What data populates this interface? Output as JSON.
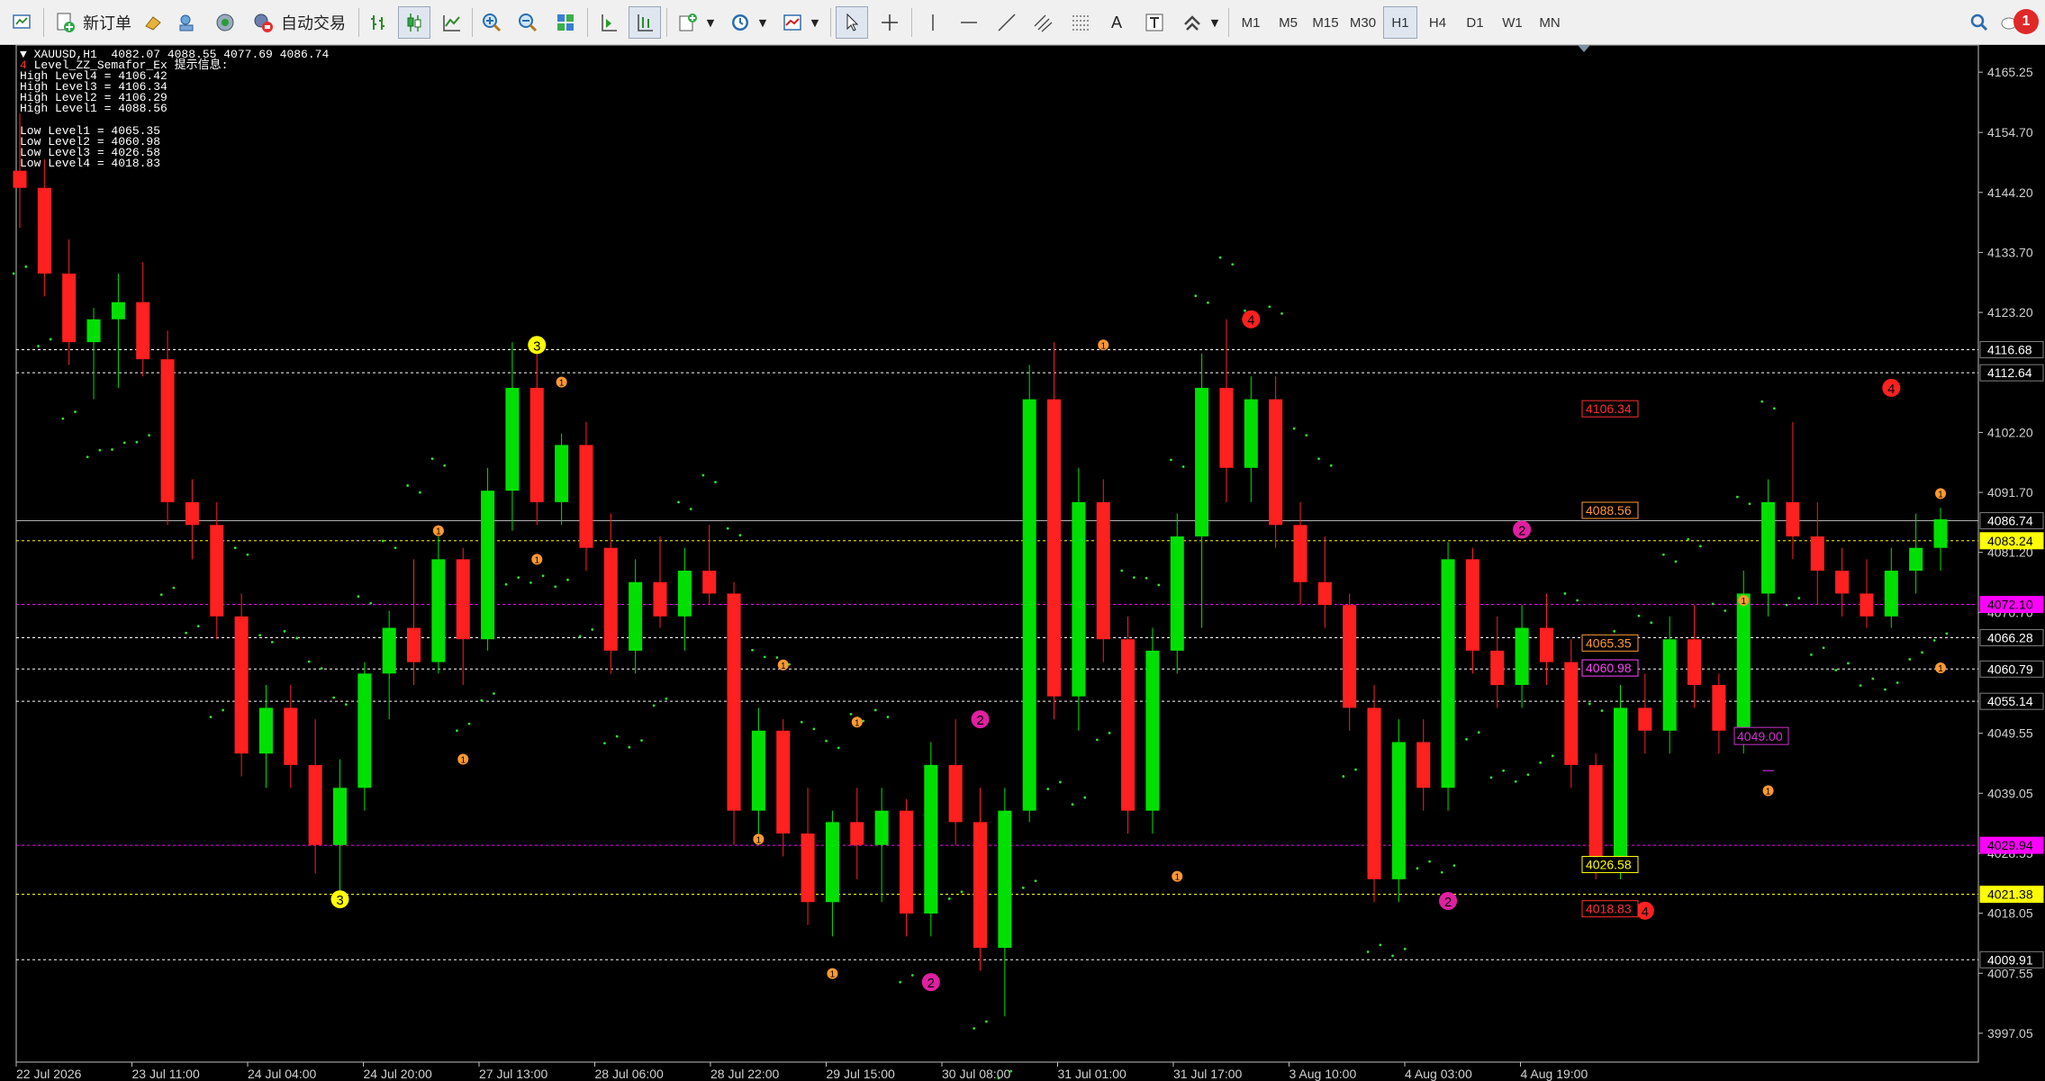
{
  "toolbar": {
    "new_order_label": "新订单",
    "auto_trade_label": "自动交易",
    "periods": [
      "M1",
      "M5",
      "M15",
      "M30",
      "H1",
      "H4",
      "D1",
      "W1",
      "MN"
    ],
    "active_period": "H1",
    "notification_count": "1"
  },
  "chart": {
    "symbol_line": "XAUUSD,H1  4082.07 4088.55 4077.69 4086.74",
    "indicator_line": "Level_ZZ_Semafor_Ex 提示信息:",
    "high_levels": [
      "High Level4 = 4106.42",
      "High Level3 = 4106.34",
      "High Level2 = 4106.29",
      "High Level1 = 4088.56"
    ],
    "low_levels": [
      "Low Level1 = 4065.35",
      "Low Level2 = 4060.98",
      "Low Level3 = 4026.58",
      "Low Level4 = 4018.83"
    ],
    "bid_price": "4086.74"
  },
  "chart_data": {
    "type": "candlestick",
    "symbol": "XAUUSD",
    "timeframe": "H1",
    "ylim": [
      3992,
      4170
    ],
    "price_ticks": [
      4165.25,
      4154.7,
      4144.2,
      4133.7,
      4123.2,
      4102.2,
      4091.7,
      4081.2,
      4070.7,
      4049.55,
      4039.05,
      4028.55,
      4018.05,
      4007.55,
      3997.05
    ],
    "time_labels": [
      "22 Jul 2026",
      "23 Jul 11:00",
      "24 Jul 04:00",
      "24 Jul 20:00",
      "27 Jul 13:00",
      "28 Jul 06:00",
      "28 Jul 22:00",
      "29 Jul 15:00",
      "30 Jul 08:00",
      "31 Jul 01:00",
      "31 Jul 17:00",
      "3 Aug 10:00",
      "4 Aug 03:00",
      "4 Aug 19:00"
    ],
    "horizontal_lines": [
      {
        "price": 4116.68,
        "label": "4116.68",
        "color": "#ffffff",
        "box": "#000000",
        "style": "dotted"
      },
      {
        "price": 4112.64,
        "label": "4112.64",
        "color": "#ffffff",
        "box": "#000000",
        "style": "dotted"
      },
      {
        "price": 4086.74,
        "label": "4086.74",
        "color": "#b0b0b0",
        "box": "#000000",
        "style": "solid"
      },
      {
        "price": 4083.24,
        "label": "4083.24",
        "color": "#ffff00",
        "box": "#ffff00",
        "style": "dotted"
      },
      {
        "price": 4072.1,
        "label": "4072.10",
        "color": "#ff00ff",
        "box": "#ff00ff",
        "style": "dotted"
      },
      {
        "price": 4066.28,
        "label": "4066.28",
        "color": "#ffffff",
        "box": "#000000",
        "style": "dotted"
      },
      {
        "price": 4060.79,
        "label": "4060.79",
        "color": "#ffffff",
        "box": "#000000",
        "style": "dotted"
      },
      {
        "price": 4055.14,
        "label": "4055.14",
        "color": "#ffffff",
        "box": "#000000",
        "style": "dotted"
      },
      {
        "price": 4029.94,
        "label": "4029.94",
        "color": "#ff00ff",
        "box": "#ff00ff",
        "style": "dotted"
      },
      {
        "price": 4021.38,
        "label": "4021.38",
        "color": "#ffff00",
        "box": "#ffff00",
        "style": "dotted"
      },
      {
        "price": 4009.91,
        "label": "4009.91",
        "color": "#ffffff",
        "box": "#000000",
        "style": "dotted"
      }
    ],
    "level_tags": [
      {
        "price": 4106.34,
        "label": "4106.34",
        "color": "#ff3030"
      },
      {
        "price": 4088.56,
        "label": "4088.56",
        "color": "#ff9933"
      },
      {
        "price": 4065.35,
        "label": "4065.35",
        "color": "#ff9933"
      },
      {
        "price": 4060.98,
        "label": "4060.98",
        "color": "#ff44ff"
      },
      {
        "price": 4026.58,
        "label": "4026.58",
        "color": "#ffff00"
      },
      {
        "price": 4018.83,
        "label": "4018.83",
        "color": "#ff3030"
      }
    ],
    "hline_4049": {
      "price": 4049.0,
      "label": "4049.00",
      "color": "#cc33cc"
    },
    "trend_line_price": 4043.0,
    "markers": [
      {
        "n": "3",
        "i": 21,
        "price": 4117.5,
        "color": "#ffff00"
      },
      {
        "n": "3",
        "i": 13,
        "price": 4020.5,
        "color": "#ffff00"
      },
      {
        "n": "4",
        "i": 50,
        "price": 4122.0,
        "color": "#ff2020"
      },
      {
        "n": "4",
        "i": 76,
        "price": 4110.0,
        "color": "#ff2020"
      },
      {
        "n": "4",
        "i": 66,
        "price": 4018.5,
        "color": "#ff2020"
      },
      {
        "n": "2",
        "i": 39,
        "price": 4052.0,
        "color": "#e020a0"
      },
      {
        "n": "2",
        "i": 37,
        "price": 4006.0,
        "color": "#e020a0"
      },
      {
        "n": "2",
        "i": 61,
        "price": 4085.2,
        "color": "#e020a0"
      },
      {
        "n": "2",
        "i": 58,
        "price": 4020.2,
        "color": "#e020a0"
      },
      {
        "n": "1",
        "i": 17,
        "price": 4085.0,
        "color": "#ff9933"
      },
      {
        "n": "1",
        "i": 22,
        "price": 4111.0,
        "color": "#ff9933"
      },
      {
        "n": "1",
        "i": 21,
        "price": 4080.0,
        "color": "#ff9933"
      },
      {
        "n": "1",
        "i": 18,
        "price": 4045.0,
        "color": "#ff9933"
      },
      {
        "n": "1",
        "i": 31,
        "price": 4061.5,
        "color": "#ff9933"
      },
      {
        "n": "1",
        "i": 34,
        "price": 4051.5,
        "color": "#ff9933"
      },
      {
        "n": "1",
        "i": 30,
        "price": 4031.0,
        "color": "#ff9933"
      },
      {
        "n": "1",
        "i": 33,
        "price": 4007.5,
        "color": "#ff9933"
      },
      {
        "n": "1",
        "i": 44,
        "price": 4117.5,
        "color": "#ff9933"
      },
      {
        "n": "1",
        "i": 47,
        "price": 4024.5,
        "color": "#ff9933"
      },
      {
        "n": "1",
        "i": 70,
        "price": 4072.8,
        "color": "#ff9933"
      },
      {
        "n": "1",
        "i": 71,
        "price": 4039.5,
        "color": "#ff9933"
      },
      {
        "n": "1",
        "i": 78,
        "price": 4091.5,
        "color": "#ff9933"
      },
      {
        "n": "1",
        "i": 78,
        "price": 4061.0,
        "color": "#ff9933"
      }
    ],
    "candles": [
      [
        4148,
        4158,
        4138,
        4145
      ],
      [
        4145,
        4150,
        4126,
        4130
      ],
      [
        4130,
        4136,
        4114,
        4118
      ],
      [
        4118,
        4124,
        4108,
        4122
      ],
      [
        4122,
        4130,
        4110,
        4125
      ],
      [
        4125,
        4132,
        4112,
        4115
      ],
      [
        4115,
        4120,
        4086,
        4090
      ],
      [
        4090,
        4094,
        4080,
        4086
      ],
      [
        4086,
        4090,
        4066,
        4070
      ],
      [
        4070,
        4074,
        4042,
        4046
      ],
      [
        4046,
        4058,
        4040,
        4054
      ],
      [
        4054,
        4058,
        4040,
        4044
      ],
      [
        4044,
        4052,
        4025,
        4030
      ],
      [
        4030,
        4045,
        4022,
        4040
      ],
      [
        4040,
        4062,
        4036,
        4060
      ],
      [
        4060,
        4071,
        4052,
        4068
      ],
      [
        4068,
        4080,
        4058,
        4062
      ],
      [
        4062,
        4084,
        4060,
        4080
      ],
      [
        4080,
        4082,
        4058,
        4066
      ],
      [
        4066,
        4096,
        4064,
        4092
      ],
      [
        4092,
        4118,
        4085,
        4110
      ],
      [
        4110,
        4116,
        4086,
        4090
      ],
      [
        4090,
        4102,
        4086,
        4100
      ],
      [
        4100,
        4104,
        4078,
        4082
      ],
      [
        4082,
        4088,
        4060,
        4064
      ],
      [
        4064,
        4080,
        4060,
        4076
      ],
      [
        4076,
        4084,
        4068,
        4070
      ],
      [
        4070,
        4082,
        4064,
        4078
      ],
      [
        4078,
        4086,
        4072,
        4074
      ],
      [
        4074,
        4076,
        4030,
        4036
      ],
      [
        4036,
        4054,
        4030,
        4050
      ],
      [
        4050,
        4052,
        4028,
        4032
      ],
      [
        4032,
        4040,
        4016,
        4020
      ],
      [
        4020,
        4036,
        4014,
        4034
      ],
      [
        4034,
        4040,
        4024,
        4030
      ],
      [
        4030,
        4040,
        4020,
        4036
      ],
      [
        4036,
        4038,
        4014,
        4018
      ],
      [
        4018,
        4048,
        4014,
        4044
      ],
      [
        4044,
        4052,
        4030,
        4034
      ],
      [
        4034,
        4040,
        4008,
        4012
      ],
      [
        4012,
        4040,
        4000,
        4036
      ],
      [
        4036,
        4114,
        4034,
        4108
      ],
      [
        4108,
        4118,
        4052,
        4056
      ],
      [
        4056,
        4096,
        4050,
        4090
      ],
      [
        4090,
        4094,
        4062,
        4066
      ],
      [
        4066,
        4070,
        4032,
        4036
      ],
      [
        4036,
        4068,
        4032,
        4064
      ],
      [
        4064,
        4088,
        4060,
        4084
      ],
      [
        4084,
        4116,
        4068,
        4110
      ],
      [
        4110,
        4122,
        4090,
        4096
      ],
      [
        4096,
        4112,
        4090,
        4108
      ],
      [
        4108,
        4112,
        4082,
        4086
      ],
      [
        4086,
        4090,
        4072,
        4076
      ],
      [
        4076,
        4084,
        4068,
        4072
      ],
      [
        4072,
        4074,
        4050,
        4054
      ],
      [
        4054,
        4058,
        4020,
        4024
      ],
      [
        4024,
        4052,
        4020,
        4048
      ],
      [
        4048,
        4052,
        4036,
        4040
      ],
      [
        4040,
        4083,
        4036,
        4080
      ],
      [
        4080,
        4082,
        4060,
        4064
      ],
      [
        4064,
        4070,
        4054,
        4058
      ],
      [
        4058,
        4072,
        4054,
        4068
      ],
      [
        4068,
        4074,
        4058,
        4062
      ],
      [
        4062,
        4066,
        4040,
        4044
      ],
      [
        4044,
        4046,
        4024,
        4028
      ],
      [
        4028,
        4058,
        4024,
        4054
      ],
      [
        4054,
        4060,
        4046,
        4050
      ],
      [
        4050,
        4070,
        4046,
        4066
      ],
      [
        4066,
        4072,
        4054,
        4058
      ],
      [
        4058,
        4060,
        4046,
        4050
      ],
      [
        4050,
        4078,
        4046,
        4074
      ],
      [
        4074,
        4094,
        4070,
        4090
      ],
      [
        4090,
        4104,
        4080,
        4084
      ],
      [
        4084,
        4090,
        4072,
        4078
      ],
      [
        4078,
        4082,
        4070,
        4074
      ],
      [
        4074,
        4080,
        4068,
        4070
      ],
      [
        4070,
        4082,
        4068,
        4078
      ],
      [
        4078,
        4088,
        4074,
        4082
      ],
      [
        4082,
        4089,
        4078,
        4087
      ]
    ]
  }
}
